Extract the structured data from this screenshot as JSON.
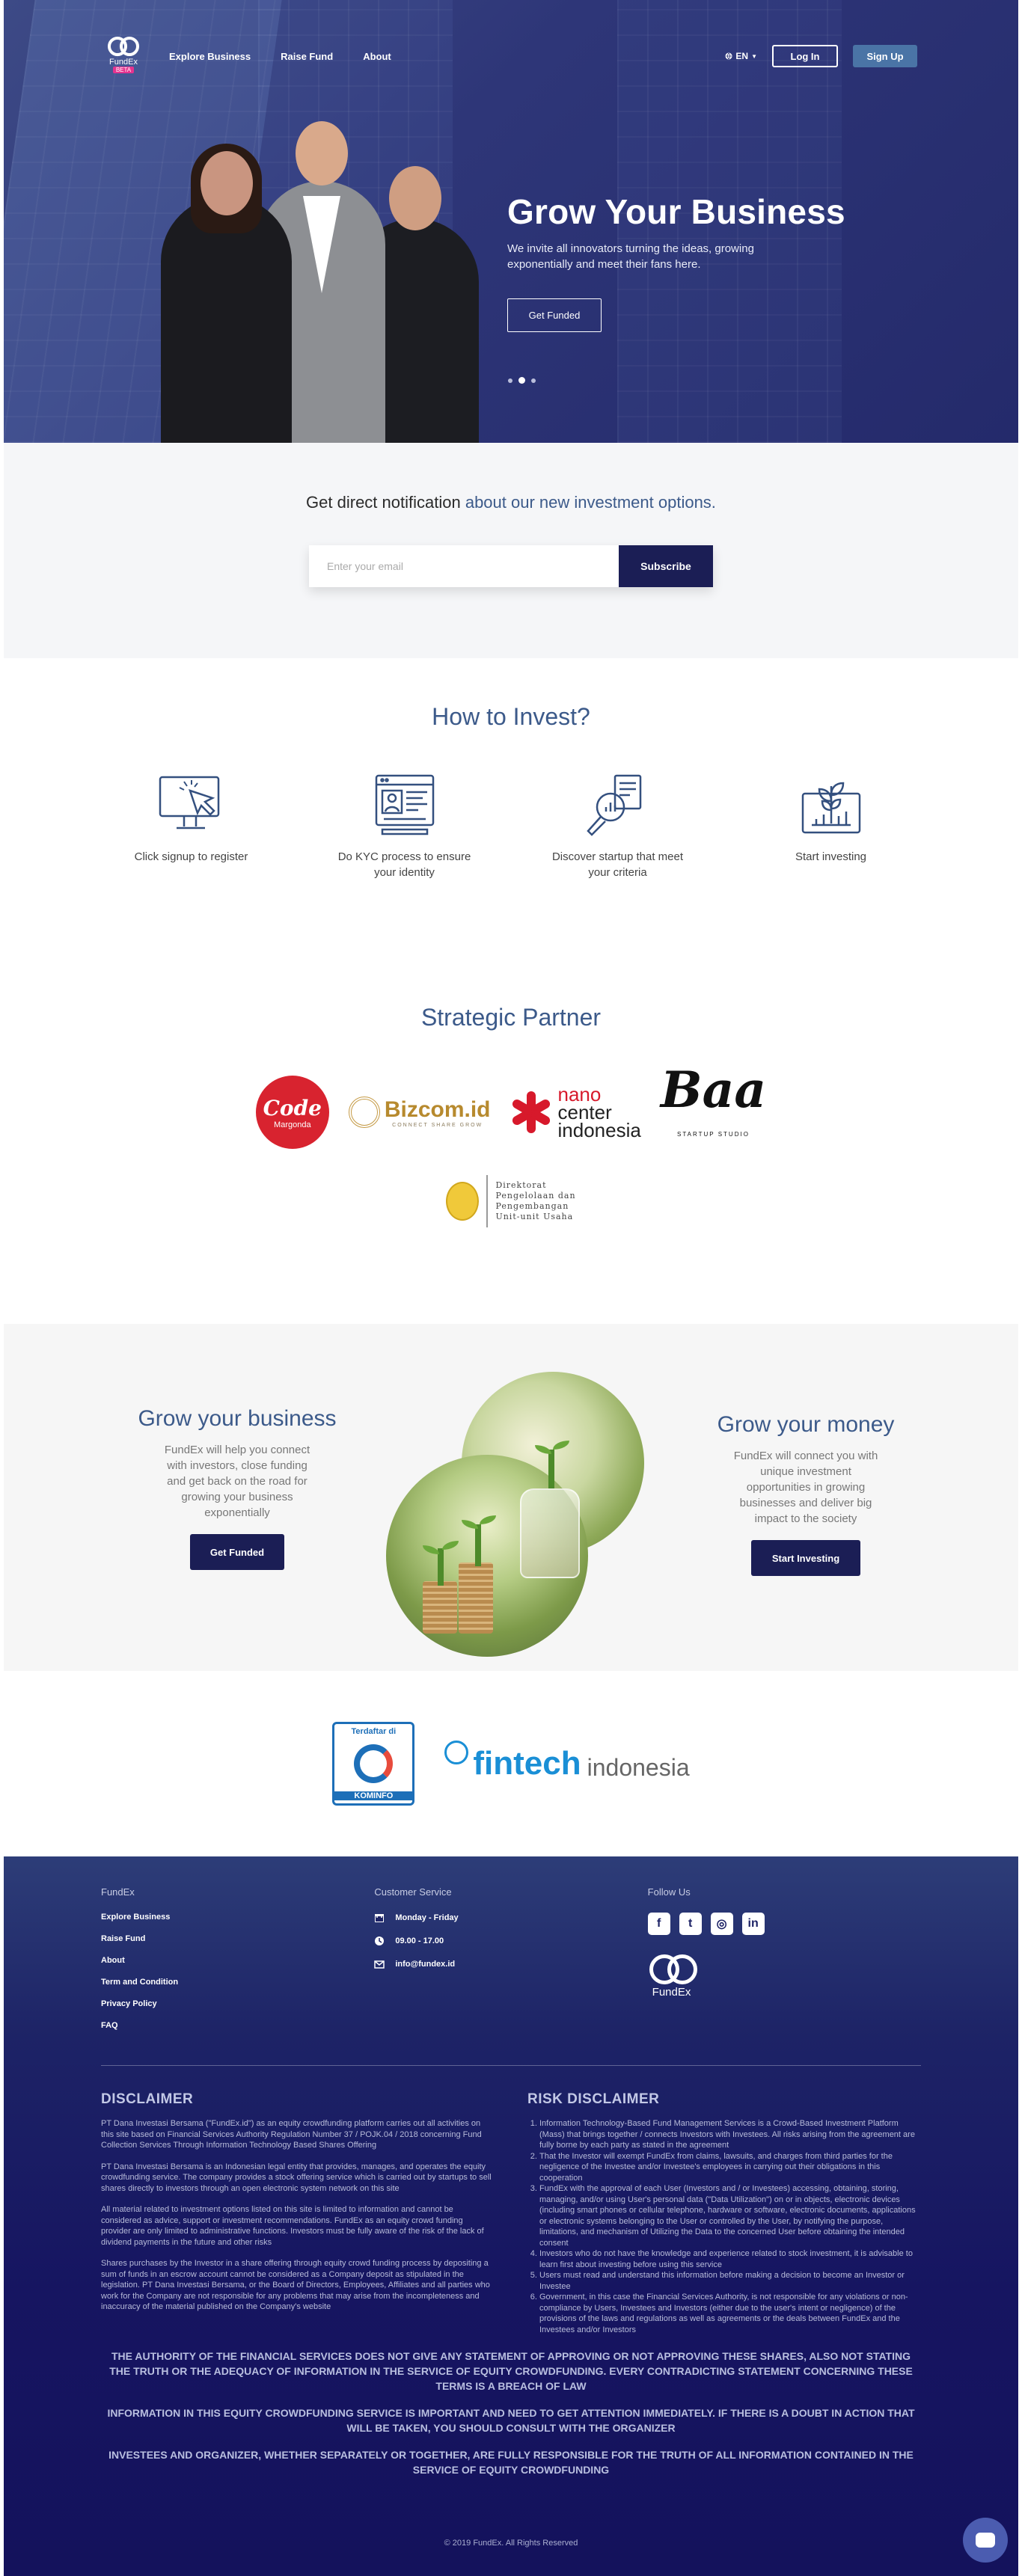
{
  "nav": {
    "brand": "FundEx",
    "beta": "BETA",
    "links": [
      "Explore Business",
      "Raise Fund",
      "About"
    ],
    "lang": "EN",
    "login": "Log In",
    "signup": "Sign Up"
  },
  "hero": {
    "title": "Grow Your Business",
    "subtitle": "We invite all innovators turning the ideas, growing exponentially and meet their fans here.",
    "cta": "Get Funded",
    "slide_count": 3,
    "active_slide": 2
  },
  "notify": {
    "title_a": "Get direct notification",
    "title_b": " about our new investment options.",
    "placeholder": "Enter your email",
    "button": "Subscribe"
  },
  "how": {
    "title": "How to Invest?",
    "steps": [
      {
        "label": "Click signup to register",
        "icon": "click-monitor-icon"
      },
      {
        "label": "Do KYC process to ensure your identity",
        "icon": "id-document-icon"
      },
      {
        "label": "Discover startup that meet your criteria",
        "icon": "magnify-search-icon"
      },
      {
        "label": "Start investing",
        "icon": "plant-growth-icon"
      }
    ]
  },
  "partners": {
    "title": "Strategic Partner",
    "code": {
      "main": "Code",
      "sub": "Margonda"
    },
    "bizcom": {
      "main": "Bizcom.id",
      "tag": "CONNECT SHARE GROW"
    },
    "nano": {
      "a": "nano",
      "b": "center",
      "c": "indonesia"
    },
    "baa": {
      "main": "Baa",
      "tag": "STARTUP STUDIO"
    },
    "dir": {
      "l1": "Direktorat",
      "l2": "Pengelolaan dan",
      "l3": "Pengembangan",
      "l4": "Unit-unit Usaha"
    }
  },
  "grow": {
    "business": {
      "title": "Grow your business",
      "text": "FundEx will help you connect with investors, close funding and get back on the road for growing your business exponentially",
      "cta": "Get Funded"
    },
    "money": {
      "title": "Grow your money",
      "text": "FundEx will connect you with unique investment opportunities in growing businesses and deliver big impact to the society",
      "cta": "Start Investing"
    }
  },
  "certs": {
    "kominfo_top": "Terdaftar di",
    "kominfo_bot": "KOMINFO",
    "fintech_a": "fintech",
    "fintech_b": "indonesia"
  },
  "footer": {
    "col1_title": "FundEx",
    "col1_links": [
      "Explore Business",
      "Raise Fund",
      "About",
      "Term and Condition",
      "Privacy Policy",
      "FAQ"
    ],
    "col2_title": "Customer Service",
    "days": "Monday - Friday",
    "hours": "09.00 - 17.00",
    "email": "info@fundex.id",
    "col3_title": "Follow Us",
    "brand": "FundEx",
    "disclaimer_title": "DISCLAIMER",
    "disclaimer": [
      "PT Dana Investasi Bersama (\"FundEx.id\") as an equity crowdfunding platform carries out all activities on this site based on Financial Services Authority Regulation Number 37 / POJK.04 / 2018 concerning Fund Collection Services Through Information Technology Based Shares Offering",
      "PT Dana Investasi Bersama is an Indonesian legal entity that provides, manages, and operates the equity crowdfunding service. The company provides a stock offering service which is carried out by startups to sell shares directly to investors through an open electronic system network on this site",
      "All material related to investment options listed on this site is limited to information and cannot be considered as advice, support or investment recommendations. FundEx as an equity crowd funding provider are only limited to administrative functions. Investors must be fully aware of the risk of the lack of dividend payments in the future and other risks",
      "Shares purchases by the Investor in a share offering through equity crowd funding process by depositing a sum of funds in an escrow account cannot be considered as a Company deposit as stipulated in the legislation. PT Dana Investasi Bersama, or the Board of Directors, Employees, Affiliates and all parties who work for the Company are not responsible for any problems that may arise from the incompleteness and inaccuracy of the material published on the Company's website"
    ],
    "risk_title": "RISK DISCLAIMER",
    "risk": [
      "Information Technology-Based Fund Management Services is a Crowd-Based Investment Platform (Mass) that brings together / connects Investors with Investees. All risks arising from the agreement are fully borne by each party as stated in the agreement",
      "That the Investor will exempt FundEx from claims, lawsuits, and charges from third parties for the negligence of the Investee and/or Investee's employees in carrying out their obligations in this cooperation",
      "FundEx with the approval of each User (Investors and / or Investees) accessing, obtaining, storing, managing, and/or using User's personal data (\"Data Utilization\") on or in objects, electronic devices (including smart phones or cellular telephone, hardware or software, electronic documents, applications or electronic systems belonging to the User or controlled by the User, by notifying the purpose, limitations, and mechanism of Utilizing the Data to the concerned User before obtaining the intended consent",
      "Investors who do not have the knowledge and experience related to stock investment, it is advisable to learn first about investing before using this service",
      "Users must read and understand this information before making a decision to become an Investor or Investee",
      "Government, in this case the Financial Services Authority, is not responsible for any violations or non-compliance by Users, Investees and Investors (either due to the user's intent or negligence) of the provisions of the laws and regulations as well as agreements or the deals between FundEx and the Investees and/or Investors"
    ],
    "caps": [
      "THE AUTHORITY OF THE FINANCIAL SERVICES DOES NOT GIVE ANY STATEMENT OF APPROVING OR NOT APPROVING THESE SHARES, ALSO NOT STATING THE TRUTH OR THE ADEQUACY OF INFORMATION IN THE SERVICE OF EQUITY CROWDFUNDING. EVERY CONTRADICTING STATEMENT CONCERNING THESE TERMS IS A BREACH OF LAW",
      "INFORMATION IN THIS EQUITY CROWDFUNDING SERVICE IS IMPORTANT AND NEED TO GET ATTENTION IMMEDIATELY. IF THERE IS A DOUBT IN ACTION THAT WILL BE TAKEN, YOU SHOULD CONSULT WITH THE ORGANIZER",
      "INVESTEES AND ORGANIZER, WHETHER SEPARATELY OR TOGETHER, ARE FULLY RESPONSIBLE FOR THE TRUTH OF ALL INFORMATION CONTAINED IN THE SERVICE OF EQUITY CROWDFUNDING"
    ],
    "copyright": "© 2019 FundEx. All Rights Reserved"
  }
}
